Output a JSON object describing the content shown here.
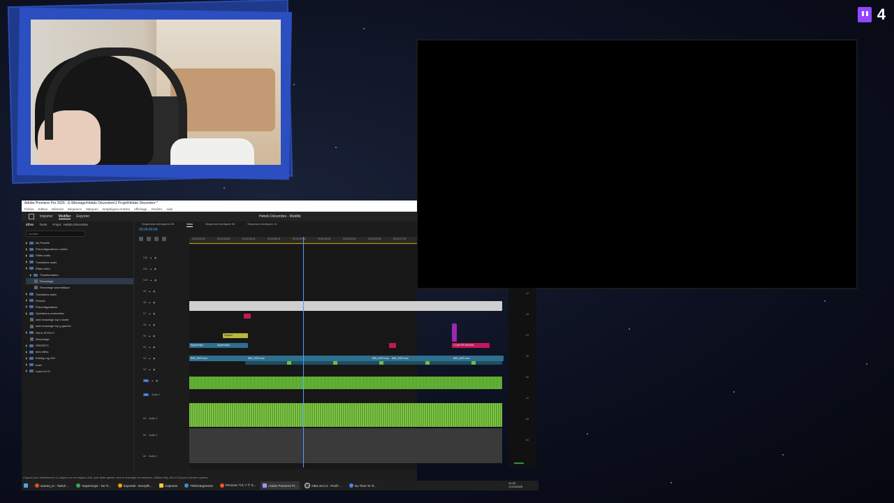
{
  "twitch": {
    "viewer_count": "4"
  },
  "premiere": {
    "window_title": "Adobe Premiere Pro 2025 - E:\\Montage\\Hebdo Décembre\\1 Projet\\Hebdo Décembre *",
    "menu": [
      "Fichier",
      "Edition",
      "Elément",
      "Séquence",
      "Marques",
      "Graphiques et titres",
      "Affichage",
      "Fenêtre",
      "Aide"
    ],
    "workspace_tabs": [
      "Importer",
      "Modifier",
      "Exporter"
    ],
    "active_workspace": "Modifier",
    "project_title": "Hebdo Décembre - Modifié",
    "left_tabs": [
      "Effets",
      "Texte",
      "Projet : Hebdo Décembre"
    ],
    "search_value": "recadra",
    "effects_tree": [
      "My Presets",
      "Préconfigurations Lumetri",
      "Effets audio",
      "Transitions audio",
      "Effets vidéo",
      "Transformation",
      "Recadrage",
      "Recadrage automatique",
      "Transitions vidéo",
      "Presets",
      "Préconfigurations",
      "Opérations vectorielles",
      "seal recadrage top d droite",
      "seal recadrage top g gauche",
      "PACK EFFECT",
      "Recadrage",
      "PRESETS",
      "Mes effets",
      "Editing Lag 300",
      "trash",
      "Listed Di Gi"
    ],
    "sequence_tabs": [
      "Séquences imbriquées 05",
      "Main",
      "Séquence imbriquée 08",
      "Séquence imbriquée 10"
    ],
    "active_sequence": "Main",
    "timecode": "00;04;40;04",
    "ruler_labels": [
      "00;03;31;04",
      "00;03;38;04",
      "00;03;45;04",
      "00;03;52;04",
      "00;03;59;04",
      "00;04;06;04",
      "00;04;13;04",
      "00;04;20;04",
      "00;04;27;04"
    ],
    "video_tracks": [
      "V12",
      "V11",
      "V10",
      "V9",
      "V8",
      "V7",
      "V6",
      "V5",
      "V4",
      "V3",
      "V2",
      "V1"
    ],
    "audio_tracks": [
      "A1",
      "A2",
      "A3",
      "A4"
    ],
    "audio_track_names": [
      "Audio 1",
      "Audio 2",
      "Audio 3",
      "Audio 4"
    ],
    "clips": {
      "supermajor_1": "Supermajor",
      "supermajor_2": "Supermajor",
      "sequence_label": "Séquen",
      "text_clip": "1 Line FB Text Bot...",
      "img_1": "IMG_4097.mov",
      "img_2": "IMG_4097.mov",
      "img_3": "IMG_4097.mov",
      "img_4": "IMG_4097.mov",
      "img_5": "IMG_4097.mov"
    },
    "meter_scale": [
      "-12",
      "-18",
      "-24",
      "-30",
      "-36",
      "-42",
      "-48",
      "-54"
    ],
    "status_text": "Cliquez pour sélectionner ou cliquez sur un espace vide, puis faites glisser vers le rectangle de sélection. Utilisez Maj, Alt et Ctrl pour d'autres options."
  },
  "taskbar": {
    "items": [
      {
        "label": "anama_tv - Twitch ..."
      },
      {
        "label": "Supermajor - No Ti..."
      },
      {
        "label": "kayoretti - Everythi..."
      },
      {
        "label": "Captures"
      },
      {
        "label": "Téléchargement"
      },
      {
        "label": "Persona ペルソナ 8..."
      },
      {
        "label": "Adobe Premiere Pr..."
      },
      {
        "label": "OBS 32.0.2 - Profil: ..."
      },
      {
        "label": "No Time To Ti..."
      }
    ],
    "time": "14:33",
    "date": "17/12/2025"
  },
  "colors": {
    "accent_blue": "#4ea0ff",
    "audio_green": "#6fbf3b",
    "clip_magenta": "#c2185b",
    "clip_purple": "#9c27b0",
    "twitch_purple": "#9146ff",
    "cam_frame_blue": "#2b4fc0"
  }
}
